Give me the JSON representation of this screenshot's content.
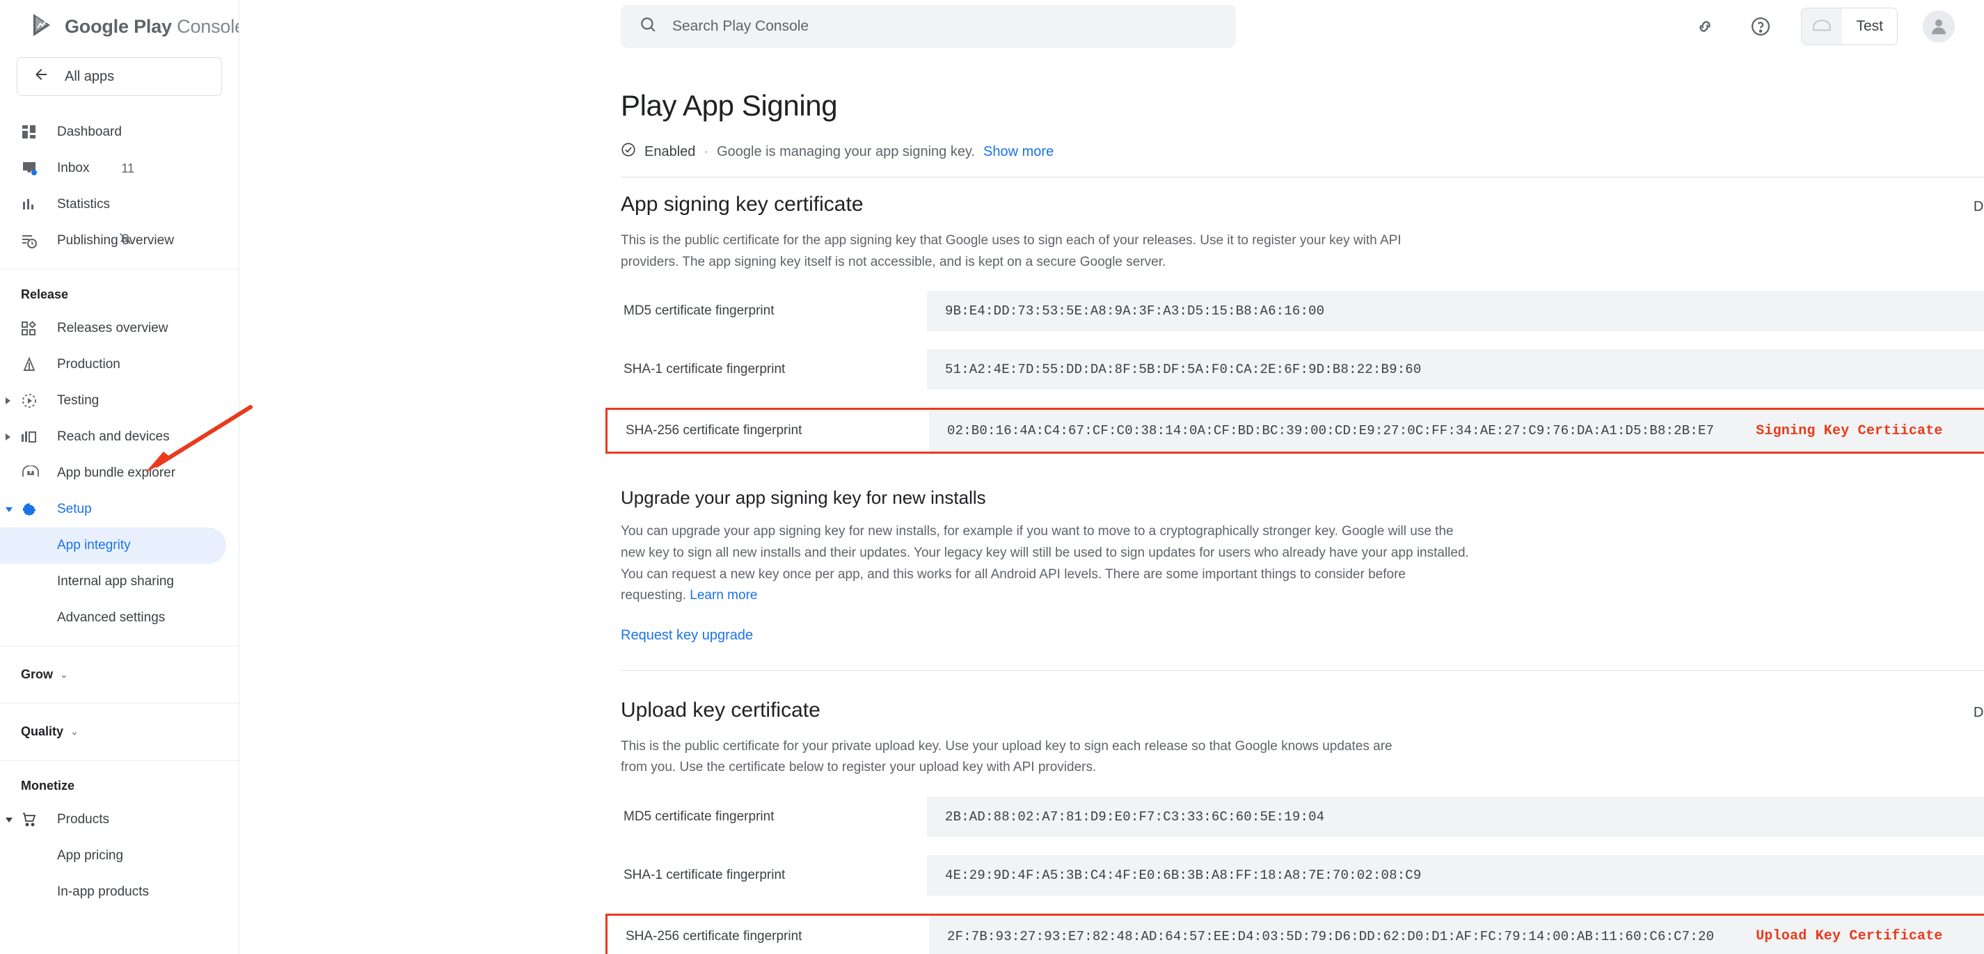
{
  "brand": {
    "name_bold": "Google Play",
    "name_light": "Console",
    "logo": "play-logo",
    "menu": "hamburger-icon"
  },
  "sidebar": {
    "all_apps": "All apps",
    "back_icon": "arrow-back-icon",
    "items": [
      {
        "label": "Dashboard",
        "icon": "dashboard-icon"
      },
      {
        "label": "Inbox",
        "icon": "inbox-icon",
        "badge": "11"
      },
      {
        "label": "Statistics",
        "icon": "statistics-icon"
      },
      {
        "label": "Publishing overview",
        "icon": "publishing-overview-icon",
        "trail_icon": "bell-off-icon"
      }
    ],
    "release": {
      "title": "Release",
      "items": [
        {
          "label": "Releases overview",
          "icon": "releases-overview-icon"
        },
        {
          "label": "Production",
          "icon": "production-icon"
        },
        {
          "label": "Testing",
          "icon": "testing-icon",
          "expandable": true
        },
        {
          "label": "Reach and devices",
          "icon": "reach-devices-icon",
          "expandable": true
        },
        {
          "label": "App bundle explorer",
          "icon": "app-bundle-icon"
        },
        {
          "label": "Setup",
          "icon": "setup-gear-icon",
          "expandable": true,
          "expanded": true,
          "active": true
        }
      ],
      "setup_children": [
        {
          "label": "App integrity",
          "active": true
        },
        {
          "label": "Internal app sharing",
          "active": false
        },
        {
          "label": "Advanced settings",
          "active": false
        }
      ]
    },
    "grow": {
      "title": "Grow",
      "chevron": "chevron-down-icon"
    },
    "quality": {
      "title": "Quality",
      "chevron": "chevron-down-icon"
    },
    "monetize": {
      "title": "Monetize",
      "items": [
        {
          "label": "Products",
          "icon": "cart-icon",
          "expanded": true
        }
      ],
      "children": [
        {
          "label": "App pricing"
        },
        {
          "label": "In-app products"
        }
      ]
    }
  },
  "topbar": {
    "search_placeholder": "Search Play Console",
    "search_icon": "search-icon",
    "link_icon": "link-icon",
    "help_icon": "help-circle-icon",
    "app_chip": {
      "name": "Test",
      "icon": "android-icon"
    },
    "avatar": "avatar-icon"
  },
  "page": {
    "title": "Play App Signing",
    "status": "Enabled",
    "status_icon": "check-circle-icon",
    "separator": "·",
    "status_note": "Google is managing your app signing key.",
    "show_more": "Show more"
  },
  "app_signing": {
    "title": "App signing key certificate",
    "download_label": "Download certificate",
    "download_icon": "download-icon",
    "description": "This is the public certificate for the app signing key that Google uses to sign each of your releases. Use it to register your key with API providers. The app signing key itself is not accessible, and is kept on a secure Google server.",
    "fingerprints": [
      {
        "label": "MD5 certificate fingerprint",
        "value": "9B:E4:DD:73:53:5E:A8:9A:3F:A3:D5:15:B8:A6:16:00",
        "copy_icon": "copy-icon",
        "highlight": false,
        "annotation": ""
      },
      {
        "label": "SHA-1 certificate fingerprint",
        "value": "51:A2:4E:7D:55:DD:DA:8F:5B:DF:5A:F0:CA:2E:6F:9D:B8:22:B9:60",
        "copy_icon": "copy-icon",
        "highlight": false,
        "annotation": ""
      },
      {
        "label": "SHA-256 certificate fingerprint",
        "value": "02:B0:16:4A:C4:67:CF:C0:38:14:0A:CF:BD:BC:39:00:CD:E9:27:0C:FF:34:AE:27:C9:76:DA:A1:D5:B8:2B:E7",
        "copy_icon": "copy-icon",
        "highlight": true,
        "annotation": "Signing Key Certiicate"
      }
    ]
  },
  "upgrade": {
    "title": "Upgrade your app signing key for new installs",
    "description": "You can upgrade your app signing key for new installs, for example if you want to move to a cryptographically stronger key. Google will use the new key to sign all new installs and their updates. Your legacy key will still be used to sign updates for users who already have your app installed. You can request a new key once per app, and this works for all Android API levels. There are some important things to consider before requesting.",
    "learn_more": "Learn more",
    "request_link": "Request key upgrade"
  },
  "upload_key": {
    "title": "Upload key certificate",
    "download_label": "Download certificate",
    "download_icon": "download-icon",
    "description": "This is the public certificate for your private upload key. Use your upload key to sign each release so that Google knows updates are from you. Use the certificate below to register your upload key with API providers.",
    "fingerprints": [
      {
        "label": "MD5 certificate fingerprint",
        "value": "2B:AD:88:02:A7:81:D9:E0:F7:C3:33:6C:60:5E:19:04",
        "copy_icon": "copy-icon",
        "highlight": false,
        "annotation": ""
      },
      {
        "label": "SHA-1 certificate fingerprint",
        "value": "4E:29:9D:4F:A5:3B:C4:4F:E0:6B:3B:A8:FF:18:A8:7E:70:02:08:C9",
        "copy_icon": "copy-icon",
        "highlight": false,
        "annotation": ""
      },
      {
        "label": "SHA-256 certificate fingerprint",
        "value": "2F:7B:93:27:93:E7:82:48:AD:64:57:EE:D4:03:5D:79:D6:DD:62:D0:D1:AF:FC:79:14:00:AB:11:60:C6:C7:20",
        "copy_icon": "copy-icon",
        "highlight": true,
        "annotation": "Upload Key Certificate"
      }
    ]
  },
  "annotations": {
    "arrow": "red-arrow-pointing-to-app-integrity",
    "color": "#ea3a1c"
  },
  "colors": {
    "accent": "#1a73e8",
    "annotation": "#ea3a1c",
    "field_bg": "#f1f3f4",
    "active_bg": "#e8f0fe"
  }
}
